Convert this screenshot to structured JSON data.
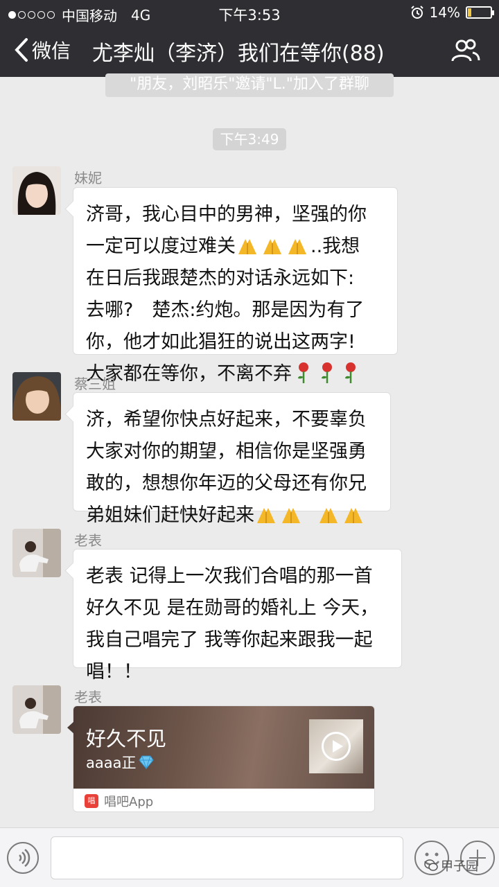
{
  "status_bar": {
    "carrier": "中国移动",
    "network": "4G",
    "time": "下午3:53",
    "battery_percent": "14%",
    "battery_level": 0.14,
    "battery_color": "#f3c63f"
  },
  "nav": {
    "back_label": "微信",
    "title": "尤李灿（李济）我们在等你(88)",
    "group_icon": "group-members-icon"
  },
  "system_notice": "\"朋友，刘昭乐\"邀请\"L.\"加入了群聊",
  "timestamp": "下午3:49",
  "messages": [
    {
      "sender": "妹妮",
      "lines": [
        "济哥，我心目中的男神，坚强的你",
        "一定可以度过难关",
        "..我想",
        "在日后我跟楚杰的对话永远如下:",
        "去哪?　楚杰:约炮。那是因为有了",
        "你，他才如此猖狂的说出这两字!",
        "大家都在等你，不离不弃"
      ]
    },
    {
      "sender": "蔡三姐",
      "lines": [
        "济，希望你快点好起来，不要辜负",
        "大家对你的期望，相信你是坚强勇",
        "敢的，想想你年迈的父母还有你兄",
        "弟姐妹们赶快好起来"
      ]
    },
    {
      "sender": "老表",
      "lines": [
        "老表 记得上一次我们合唱的那一首",
        "好久不见 是在勋哥的婚礼上 今天，",
        "我自己唱完了 我等你起来跟我一起",
        "唱！！"
      ]
    },
    {
      "sender": "老表",
      "card": {
        "title": "好久不见",
        "subtitle": "aaaa正",
        "app_icon_text": "唱",
        "app_name": "唱吧App"
      }
    }
  ],
  "input_bar": {
    "voice_icon": "voice-icon",
    "emoji_icon": "emoji-icon",
    "plus_icon": "plus-icon"
  },
  "watermark": "甲子园"
}
